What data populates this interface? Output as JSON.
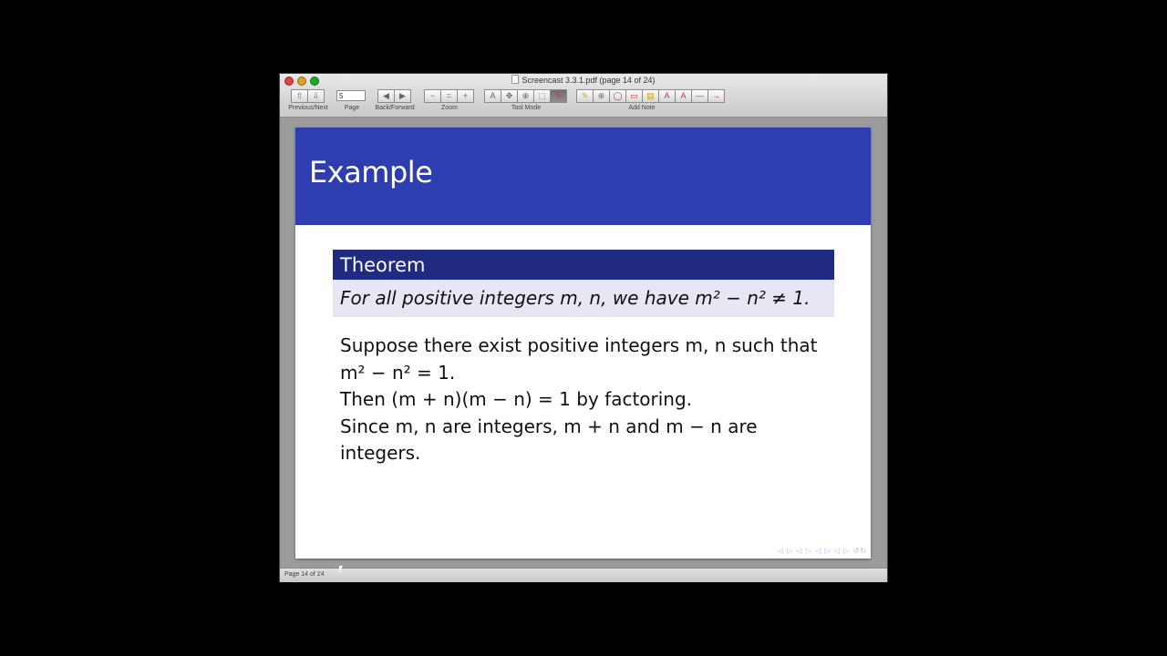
{
  "window": {
    "title": "Screencast 3.3.1.pdf (page 14 of 24)"
  },
  "toolbar": {
    "page_value": "5",
    "labels": {
      "prev_next": "Previous/Next",
      "page": "Page",
      "back_forward": "Back/Forward",
      "zoom": "Zoom",
      "tool_mode": "Tool Mode",
      "add_note": "Add Note"
    },
    "glyphs": {
      "up": "⇧",
      "down": "⇩",
      "back": "◀",
      "forward": "▶",
      "zoom_out": "−",
      "zoom_fit": "=",
      "zoom_in": "+",
      "text_tool": "A",
      "move_tool": "✥",
      "zoom_tool": "⊕",
      "select_tool": "⬚",
      "annotate_tool": "✎",
      "highlight": "✎",
      "magnify": "⊕",
      "oval": "◯",
      "rect": "▭",
      "note": "▤",
      "text_note": "A",
      "strike": "A",
      "line": "—",
      "arrow": "→"
    }
  },
  "slide": {
    "title": "Example",
    "theorem_title": "Theorem",
    "theorem_text": "For all positive integers m, n, we have m² − n² ≠ 1.",
    "proof_lines": [
      "Suppose there exist positive integers m, n such that",
      "m² − n² = 1.",
      "Then (m + n)(m − n) = 1 by factoring.",
      "Since m, n are integers, m + n and m − n are",
      "integers."
    ],
    "nav_symbols": "◁ ▷ ◁ ▷ ◁ ▷ ◁ ▷   ↺↻"
  },
  "status": {
    "text": "Page 14 of 24"
  }
}
